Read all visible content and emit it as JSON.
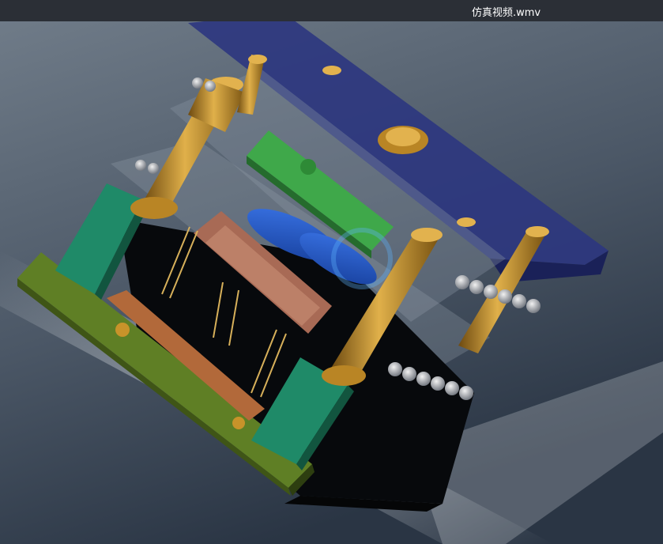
{
  "window": {
    "title": "仿真视频.wmv"
  },
  "video": {
    "subject": "mold-assembly-3d-render",
    "colors": {
      "background_top": "#5e6a78",
      "background_bottom": "#253140",
      "plate_blue": "#2e3a8a",
      "plate_green": "#3f9a4a",
      "plate_teal": "#1f7a63",
      "plate_olive": "#6a8a2a",
      "plate_orange": "#b56a3a",
      "brass": "#c8932a",
      "part_blue": "#2a5fd0",
      "glass": "#9aa6b0"
    }
  }
}
